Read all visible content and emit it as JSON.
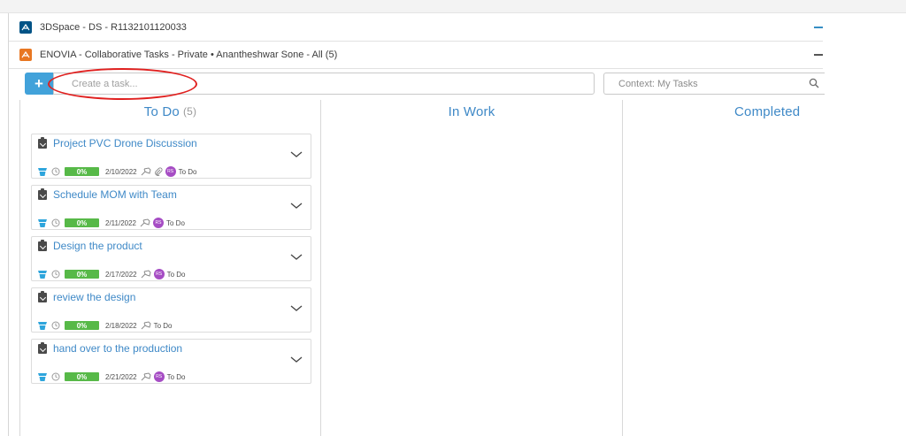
{
  "apps": [
    {
      "title": "3DSpace - DS - R1132101120033",
      "icon": "3dspace-icon",
      "color": "#005386"
    },
    {
      "title": "ENOVIA - Collaborative Tasks - Private • Anantheshwar Sone - All (5)",
      "icon": "enovia-icon",
      "color": "#e87722"
    }
  ],
  "toolbar": {
    "add_label": "+",
    "task_placeholder": "Create a task...",
    "context_text": "Context: My Tasks",
    "search_icon": "search-icon"
  },
  "columns": [
    {
      "title": "To Do",
      "count": "(5)"
    },
    {
      "title": "In Work",
      "count": ""
    },
    {
      "title": "Completed",
      "count": ""
    }
  ],
  "tasks": [
    {
      "title": "Project PVC Drone Discussion",
      "progress": "0%",
      "due": "2/10/2022",
      "assignee": "RS",
      "attachment": true,
      "status": "To Do"
    },
    {
      "title": "Schedule MOM with Team",
      "progress": "0%",
      "due": "2/11/2022",
      "assignee": "RS",
      "attachment": false,
      "status": "To Do"
    },
    {
      "title": "Design the product",
      "progress": "0%",
      "due": "2/17/2022",
      "assignee": "RS",
      "attachment": false,
      "status": "To Do"
    },
    {
      "title": "review the design",
      "progress": "0%",
      "due": "2/18/2022",
      "assignee": "",
      "attachment": false,
      "status": "To Do"
    },
    {
      "title": "hand over to the production",
      "progress": "0%",
      "due": "2/21/2022",
      "assignee": "RS",
      "attachment": false,
      "status": "To Do"
    }
  ],
  "colors": {
    "accent_blue": "#3f89c7",
    "add_button": "#42a2da",
    "progress_green": "#57b948",
    "avatar_purple": "#a64dc4",
    "annotation_red": "#e0201f"
  }
}
